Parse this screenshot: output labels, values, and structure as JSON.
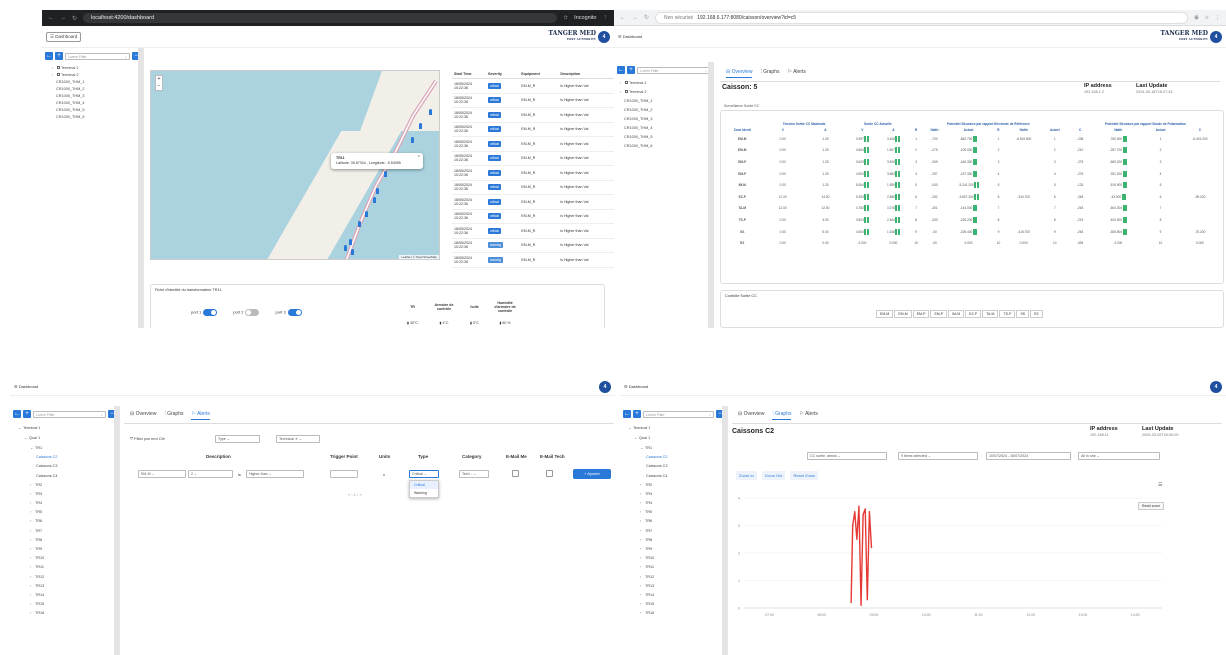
{
  "q1": {
    "url": "localhost:4200/dashboard",
    "incognito": "Incognito",
    "dashboard_btn": "☰ Dashboard",
    "logo_main": "TANGER MED",
    "logo_sub": "PORT AUTHORITY",
    "filter_placeholder": "Lorem Filter",
    "tree": [
      "Terminal 1",
      "Terminal 2",
      "CR1000_THM_1",
      "CR1000_THM_2",
      "CR1000_THM_3",
      "CR1000_THM_4",
      "CR1000_THM_5",
      "CR1000_THM_6"
    ],
    "zoom_in": "+",
    "zoom_out": "−",
    "popup_title": "TR11",
    "popup_text": "Latitude: 35.87304 , Longitude: -5.54055",
    "popup_close": "×",
    "attribution": "Leaflet | © OpenStreetMap",
    "alert_headers": [
      "Start Time",
      "Severity",
      "Equipment",
      "Description"
    ],
    "alerts": [
      {
        "time": "18/05/2024 10:22:36",
        "sev": "critical",
        "eq": "EM-M_R",
        "desc": "is Higher than Val"
      },
      {
        "time": "18/05/2024 10:22:36",
        "sev": "critical",
        "eq": "EM-M_R",
        "desc": "is Higher than Val"
      },
      {
        "time": "18/05/2024 10:22:36",
        "sev": "critical",
        "eq": "EM-M_R",
        "desc": "is Higher than Val"
      },
      {
        "time": "18/05/2024 10:22:36",
        "sev": "critical",
        "eq": "EM-M_R",
        "desc": "is Higher than Val"
      },
      {
        "time": "18/05/2024 10:22:36",
        "sev": "critical",
        "eq": "EM-M_R",
        "desc": "is Higher than Val"
      },
      {
        "time": "18/05/2024 10:22:36",
        "sev": "critical",
        "eq": "EM-M_R",
        "desc": "is Higher than Val"
      },
      {
        "time": "18/05/2024 10:22:36",
        "sev": "critical",
        "eq": "EM-M_R",
        "desc": "is Higher than Val"
      },
      {
        "time": "18/05/2024 10:22:36",
        "sev": "critical",
        "eq": "EM-M_R",
        "desc": "is Higher than Val"
      },
      {
        "time": "18/05/2024 10:22:36",
        "sev": "critical",
        "eq": "EM-M_R",
        "desc": "is Higher than Val"
      },
      {
        "time": "18/05/2024 10:22:36",
        "sev": "critical",
        "eq": "EM-M_R",
        "desc": "is Higher than Val"
      },
      {
        "time": "18/05/2024 10:22:36",
        "sev": "critical",
        "eq": "EM-M_R",
        "desc": "is Higher than Val"
      },
      {
        "time": "18/05/2024 10:22:36",
        "sev": "warning",
        "eq": "EM-M_R",
        "desc": "is Higher than Val"
      },
      {
        "time": "18/05/2024 10:22:36",
        "sev": "warning",
        "eq": "EM-M_R",
        "desc": "is Higher than Val"
      }
    ],
    "fiche_title": "Fiche d'identité du transformateur TR11",
    "ports": [
      "port 1",
      "port 2",
      "port 3"
    ],
    "ports_on": [
      true,
      false,
      true
    ],
    "sensor_headers": [
      "TR",
      "Armoire de contrôle",
      "huile",
      "Humidité d'armoire de contrôle"
    ],
    "sensor_values": [
      "30°C",
      "4°C",
      "0°C",
      "60 %"
    ]
  },
  "q2": {
    "not_secure": "Non sécurisé",
    "url": "192.168.6.177:8080/caisson/overview?id=c5",
    "dashboard": "☰ Dashboard",
    "logo_main": "TANGER MED",
    "logo_sub": "PORT AUTHORITY",
    "filter_placeholder": "Lorem Filter",
    "tree": [
      "Terminal 1",
      "Terminal 2",
      "CR1000_THM_1",
      "CR1000_THM_2",
      "CR1000_THM_3",
      "CR1000_THM_4",
      "CR1000_THM_5",
      "CR1000_THM_6"
    ],
    "tabs": [
      "Overview",
      "Graphs",
      "Alerts"
    ],
    "title": "Caisson: 5",
    "ip_label": "IP address",
    "ip_value": "192.168.1.2",
    "update_label": "Last Update",
    "update_value": "2024-05-18T16:27:43",
    "surv_title": "Surveillance Sortie CC",
    "group_headers": [
      "Tension Sortie CC Maximale",
      "Sortie CC Actuelle",
      "Potentiel Structure par rapport Electrode de Référence",
      "Potentiel Structure par rapport Sonde de Polarisation"
    ],
    "sub_headers": [
      "Zone Identi",
      "V",
      "A",
      "V",
      "A",
      "R",
      "Nalth",
      "Actuel",
      "R",
      "Nalth",
      "Actuel",
      "C",
      "Nalth",
      "Actuel",
      "C",
      "Nalth",
      "Actuel"
    ],
    "rows": [
      [
        "EM-M",
        "0.00",
        "1.25",
        "3.997",
        "3.406",
        "1",
        "-700",
        "-862.700",
        "1",
        "-6.519.800",
        "1",
        "-238",
        "-760.300",
        "1",
        "-6.401.000"
      ],
      [
        "EM-M",
        "0.00",
        "1.25",
        "4.664",
        "1.507",
        "2",
        "-275",
        "-209.000",
        "2",
        "",
        "2",
        "-210",
        "-257.700",
        "2",
        ""
      ],
      [
        "EM-P",
        "0.00",
        "1.25",
        "3.629",
        "3.490",
        "3",
        "-269",
        "-440.300",
        "3",
        "",
        "3",
        "-275",
        "-669.200",
        "3",
        ""
      ],
      [
        "EM-P",
        "0.00",
        "1.25",
        "4.900",
        "3.683",
        "4",
        "-257",
        "-157.300",
        "4",
        "",
        "4",
        "-276",
        "-391.200",
        "4",
        ""
      ],
      [
        "IM-M",
        "0.00",
        "1.25",
        "5.064",
        "1.559",
        "5",
        "-040",
        "-5.241.200",
        "5",
        "",
        "5",
        "-133",
        "-519.900",
        "5",
        ""
      ],
      [
        "EZ-P",
        "12.00",
        "14.00",
        "5.283",
        "2.885",
        "6",
        "-252",
        "-3.807.300",
        "6",
        "-334.700",
        "6",
        "-264",
        "-43.900",
        "6",
        "-95.200"
      ],
      [
        "TA-M",
        "12.00",
        "12.00",
        "4.783",
        "3.378",
        "7",
        "-301",
        "-144.000",
        "7",
        "",
        "7",
        "-263",
        "-604.300",
        "7",
        ""
      ],
      [
        "TS-P",
        "0.00",
        "4.00",
        "3.803",
        "2.464",
        "8",
        "-333",
        "-226.200",
        "8",
        "",
        "8",
        "-219",
        "-400.900",
        "8",
        ""
      ],
      [
        "SS",
        "0.00",
        "5.00",
        "4.500",
        "1.538",
        "9",
        "-00",
        "-205.400",
        "9",
        "-415.700",
        "9",
        "-264",
        "-305.800",
        "9",
        "-75.200"
      ],
      [
        "R2",
        "0.00",
        "0.00",
        "0.000",
        "0.000",
        "10",
        "-00",
        "0.000",
        "10",
        "0.000",
        "10",
        "-394",
        "0.000",
        "10",
        "0.000"
      ]
    ],
    "ctrl_title": "Contrôle Sortie CC",
    "ctrl_items": [
      "EM-M",
      "EM-M",
      "EM-P",
      "EM-P",
      "IM-M",
      "EZ-P",
      "TA-M",
      "TS-P",
      "SS",
      "R2"
    ]
  },
  "q3": {
    "dashboard": "☰ Dashboard",
    "filter_placeholder": "Lorem Filter",
    "tree": [
      {
        "t": "Terminal 1",
        "lvl": 0,
        "open": true
      },
      {
        "t": "Quai 1",
        "lvl": 1,
        "open": true
      },
      {
        "t": "TR1",
        "lvl": 2,
        "open": true
      },
      {
        "t": "Caissons C2",
        "lvl": 3,
        "sel": true
      },
      {
        "t": "Caissons C3",
        "lvl": 3
      },
      {
        "t": "Caissons C4",
        "lvl": 3
      },
      {
        "t": "TR2",
        "lvl": 2
      },
      {
        "t": "TR3",
        "lvl": 2
      },
      {
        "t": "TR4",
        "lvl": 2
      },
      {
        "t": "TR5",
        "lvl": 2
      },
      {
        "t": "TR6",
        "lvl": 2
      },
      {
        "t": "TR7",
        "lvl": 2
      },
      {
        "t": "TR8",
        "lvl": 2
      },
      {
        "t": "TR9",
        "lvl": 2
      },
      {
        "t": "TR10",
        "lvl": 2
      },
      {
        "t": "TR11",
        "lvl": 2
      },
      {
        "t": "TR12",
        "lvl": 2
      },
      {
        "t": "TR13",
        "lvl": 2
      },
      {
        "t": "TR14",
        "lvl": 2
      },
      {
        "t": "TR15",
        "lvl": 2
      },
      {
        "t": "TR16",
        "lvl": 2
      }
    ],
    "tabs": [
      "Overview",
      "Graphs",
      "Alerts"
    ],
    "filter_label": "Filter par mot Clé",
    "type_select": "Type",
    "tech_select": "Technical",
    "col_headers": [
      "Description",
      "Trigger Point",
      "Units",
      "Type",
      "Category",
      "E-Mail Me",
      "E-Mail Tech"
    ],
    "eq_value": "EM-M",
    "idx_value": "2",
    "is_text": "is",
    "cond_value": "Higher than",
    "units_value": "v",
    "type_value": "Critical",
    "cat_value": "Tech...",
    "add_btn": "+ Ajouter",
    "dd_options": [
      "Critical",
      "Warning"
    ],
    "pager": "« ‹ 1 › »"
  },
  "q4": {
    "dashboard": "☰ Dashboard",
    "filter_placeholder": "Lorem Filter",
    "tree": [
      {
        "t": "Terminal 1",
        "lvl": 0,
        "open": true
      },
      {
        "t": "Quai 1",
        "lvl": 1,
        "open": true
      },
      {
        "t": "TR1",
        "lvl": 2,
        "open": true
      },
      {
        "t": "Caissons C2",
        "lvl": 3,
        "sel": true
      },
      {
        "t": "Caissons C3",
        "lvl": 3
      },
      {
        "t": "Caissons C4",
        "lvl": 3
      },
      {
        "t": "TR2",
        "lvl": 2
      },
      {
        "t": "TR3",
        "lvl": 2
      },
      {
        "t": "TR4",
        "lvl": 2
      },
      {
        "t": "TR5",
        "lvl": 2
      },
      {
        "t": "TR6",
        "lvl": 2
      },
      {
        "t": "TR7",
        "lvl": 2
      },
      {
        "t": "TR8",
        "lvl": 2
      },
      {
        "t": "TR9",
        "lvl": 2
      },
      {
        "t": "TR10",
        "lvl": 2
      },
      {
        "t": "TR11",
        "lvl": 2
      },
      {
        "t": "TR12",
        "lvl": 2
      },
      {
        "t": "TR13",
        "lvl": 2
      },
      {
        "t": "TR14",
        "lvl": 2
      },
      {
        "t": "TR15",
        "lvl": 2
      },
      {
        "t": "TR16",
        "lvl": 2
      }
    ],
    "tabs": [
      "Overview",
      "Graphs",
      "Alerts"
    ],
    "title": "Caissons C2",
    "ip_label": "IP address",
    "ip_value": "192.168.11",
    "update_label": "Last Update",
    "update_value": "2005-03-02T00:00:00",
    "sel1": "CC sortie, atmos",
    "sel2": "9 items selected",
    "sel3": "10/07/2024 - 15/07/2024",
    "sel4": "All in one",
    "zoom_in": "Zoom In",
    "zoom_out": "Zoom Out",
    "reset_zoom": "Reset Zoom",
    "reset_small": "Reset zoom",
    "menu_icon": "☰"
  },
  "chart_data": {
    "type": "line",
    "title": "",
    "xlabel": "",
    "ylabel": "",
    "x_ticks": [
      "07:00",
      "08:00",
      "09:00",
      "10:00",
      "11:00",
      "12:00",
      "13:00",
      "14:00"
    ],
    "y_ticks": [
      "4",
      "3",
      "2",
      "1",
      "0"
    ],
    "ylim": [
      0,
      4
    ],
    "series": [
      {
        "color": "#e53935",
        "points": [
          [
            8.55,
            0.2
          ],
          [
            8.58,
            3.0
          ],
          [
            8.62,
            3.5
          ],
          [
            8.66,
            2.5
          ],
          [
            8.7,
            3.7
          ],
          [
            8.74,
            0.1
          ],
          [
            8.78,
            3.4
          ],
          [
            8.82,
            3.6
          ],
          [
            8.86,
            0.3
          ],
          [
            8.9,
            3.5
          ],
          [
            8.94,
            2.2
          ]
        ]
      }
    ]
  }
}
